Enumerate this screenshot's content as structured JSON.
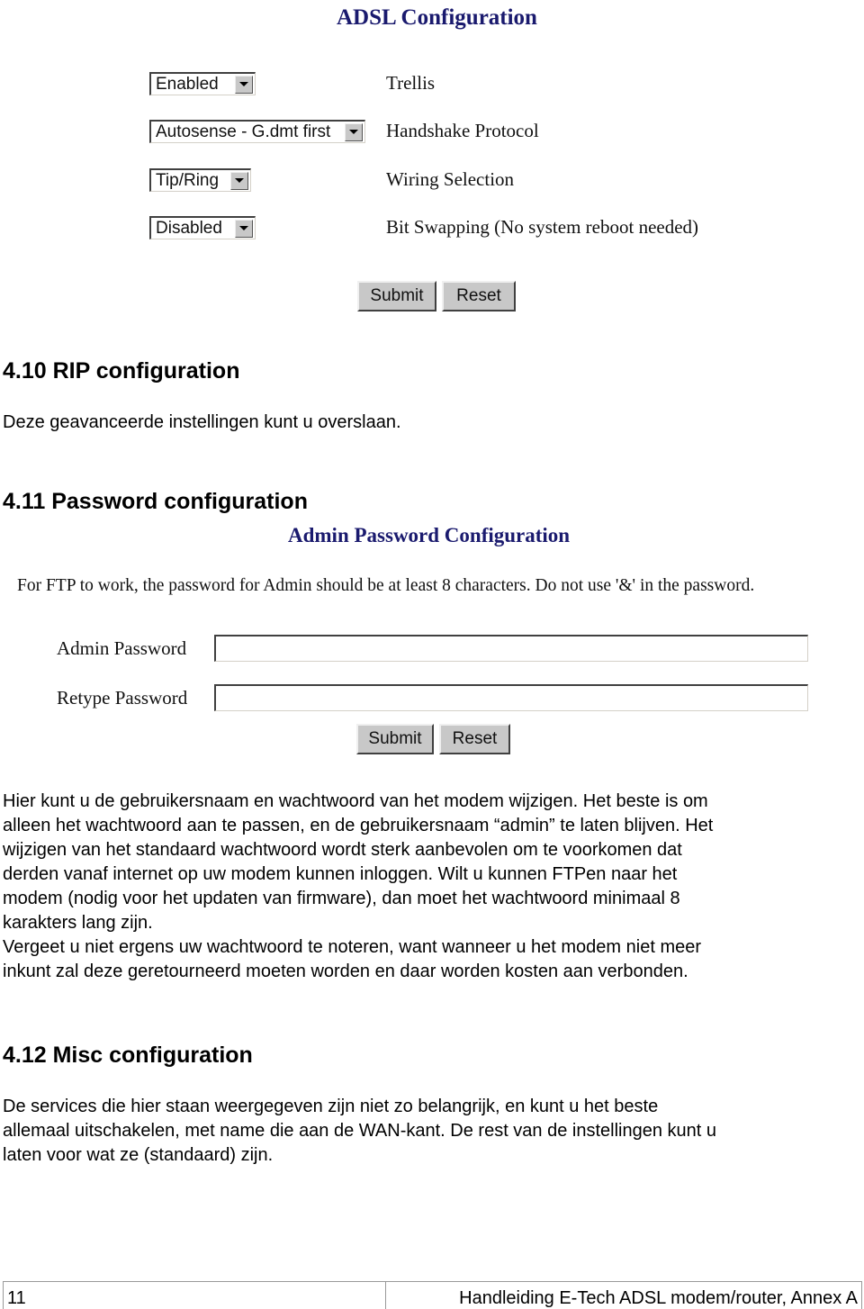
{
  "adsl": {
    "title": "ADSL Configuration",
    "rows": [
      {
        "value": "Enabled",
        "label": "Trellis"
      },
      {
        "value": "Autosense - G.dmt first",
        "label": "Handshake Protocol"
      },
      {
        "value": "Tip/Ring",
        "label": "Wiring Selection"
      },
      {
        "value": "Disabled",
        "label": "Bit Swapping (No system reboot needed)"
      }
    ],
    "submit_label": "Submit",
    "reset_label": "Reset"
  },
  "section_410": {
    "heading": "4.10 RIP configuration",
    "text": "Deze geavanceerde instellingen kunt u overslaan."
  },
  "section_411": {
    "heading": "4.11 Password configuration"
  },
  "admin_password": {
    "title": "Admin Password Configuration",
    "notice": "For FTP to work, the password for Admin should be at least 8 characters. Do not use '&' in the password.",
    "admin_label": "Admin Password",
    "admin_value": "",
    "retype_label": "Retype Password",
    "retype_value": "",
    "submit_label": "Submit",
    "reset_label": "Reset"
  },
  "password_paragraph": {
    "lines": [
      "Hier kunt u de gebruikersnaam en wachtwoord van het modem wijzigen. Het beste is om",
      "alleen het wachtwoord aan te passen, en de gebruikersnaam “admin” te laten blijven. Het",
      "wijzigen van het standaard wachtwoord wordt sterk aanbevolen om te voorkomen dat",
      "derden vanaf internet op uw modem kunnen inloggen. Wilt u kunnen FTPen naar het",
      "modem (nodig voor het updaten van firmware), dan moet het wachtwoord minimaal 8",
      "karakters lang zijn.",
      "Vergeet u niet ergens uw wachtwoord te noteren, want wanneer u het modem niet meer",
      "inkunt zal deze geretourneerd moeten worden en daar worden kosten aan verbonden."
    ]
  },
  "section_412": {
    "heading": "4.12 Misc configuration",
    "lines": [
      "De services die hier staan weergegeven zijn niet zo belangrijk, en kunt u het beste",
      "allemaal uitschakelen, met name die aan de WAN-kant. De rest van de instellingen kunt u",
      "laten voor wat ze (standaard) zijn."
    ]
  },
  "footer": {
    "page_number": "11",
    "doc_title": "Handleiding E-Tech ADSL modem/router, Annex A"
  }
}
